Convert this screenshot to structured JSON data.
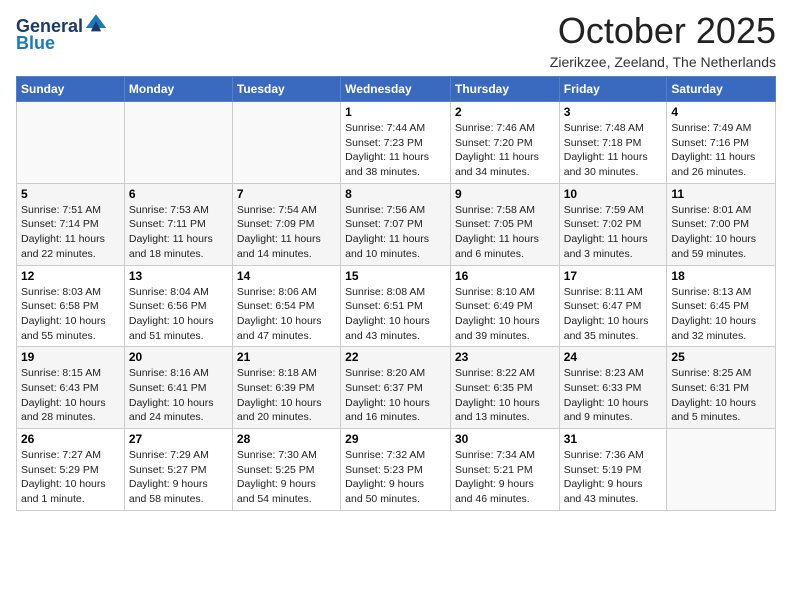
{
  "header": {
    "logo_line1": "General",
    "logo_line2": "Blue",
    "title": "October 2025",
    "location": "Zierikzee, Zeeland, The Netherlands"
  },
  "weekdays": [
    "Sunday",
    "Monday",
    "Tuesday",
    "Wednesday",
    "Thursday",
    "Friday",
    "Saturday"
  ],
  "weeks": [
    [
      {
        "day": "",
        "info": ""
      },
      {
        "day": "",
        "info": ""
      },
      {
        "day": "",
        "info": ""
      },
      {
        "day": "1",
        "info": "Sunrise: 7:44 AM\nSunset: 7:23 PM\nDaylight: 11 hours\nand 38 minutes."
      },
      {
        "day": "2",
        "info": "Sunrise: 7:46 AM\nSunset: 7:20 PM\nDaylight: 11 hours\nand 34 minutes."
      },
      {
        "day": "3",
        "info": "Sunrise: 7:48 AM\nSunset: 7:18 PM\nDaylight: 11 hours\nand 30 minutes."
      },
      {
        "day": "4",
        "info": "Sunrise: 7:49 AM\nSunset: 7:16 PM\nDaylight: 11 hours\nand 26 minutes."
      }
    ],
    [
      {
        "day": "5",
        "info": "Sunrise: 7:51 AM\nSunset: 7:14 PM\nDaylight: 11 hours\nand 22 minutes."
      },
      {
        "day": "6",
        "info": "Sunrise: 7:53 AM\nSunset: 7:11 PM\nDaylight: 11 hours\nand 18 minutes."
      },
      {
        "day": "7",
        "info": "Sunrise: 7:54 AM\nSunset: 7:09 PM\nDaylight: 11 hours\nand 14 minutes."
      },
      {
        "day": "8",
        "info": "Sunrise: 7:56 AM\nSunset: 7:07 PM\nDaylight: 11 hours\nand 10 minutes."
      },
      {
        "day": "9",
        "info": "Sunrise: 7:58 AM\nSunset: 7:05 PM\nDaylight: 11 hours\nand 6 minutes."
      },
      {
        "day": "10",
        "info": "Sunrise: 7:59 AM\nSunset: 7:02 PM\nDaylight: 11 hours\nand 3 minutes."
      },
      {
        "day": "11",
        "info": "Sunrise: 8:01 AM\nSunset: 7:00 PM\nDaylight: 10 hours\nand 59 minutes."
      }
    ],
    [
      {
        "day": "12",
        "info": "Sunrise: 8:03 AM\nSunset: 6:58 PM\nDaylight: 10 hours\nand 55 minutes."
      },
      {
        "day": "13",
        "info": "Sunrise: 8:04 AM\nSunset: 6:56 PM\nDaylight: 10 hours\nand 51 minutes."
      },
      {
        "day": "14",
        "info": "Sunrise: 8:06 AM\nSunset: 6:54 PM\nDaylight: 10 hours\nand 47 minutes."
      },
      {
        "day": "15",
        "info": "Sunrise: 8:08 AM\nSunset: 6:51 PM\nDaylight: 10 hours\nand 43 minutes."
      },
      {
        "day": "16",
        "info": "Sunrise: 8:10 AM\nSunset: 6:49 PM\nDaylight: 10 hours\nand 39 minutes."
      },
      {
        "day": "17",
        "info": "Sunrise: 8:11 AM\nSunset: 6:47 PM\nDaylight: 10 hours\nand 35 minutes."
      },
      {
        "day": "18",
        "info": "Sunrise: 8:13 AM\nSunset: 6:45 PM\nDaylight: 10 hours\nand 32 minutes."
      }
    ],
    [
      {
        "day": "19",
        "info": "Sunrise: 8:15 AM\nSunset: 6:43 PM\nDaylight: 10 hours\nand 28 minutes."
      },
      {
        "day": "20",
        "info": "Sunrise: 8:16 AM\nSunset: 6:41 PM\nDaylight: 10 hours\nand 24 minutes."
      },
      {
        "day": "21",
        "info": "Sunrise: 8:18 AM\nSunset: 6:39 PM\nDaylight: 10 hours\nand 20 minutes."
      },
      {
        "day": "22",
        "info": "Sunrise: 8:20 AM\nSunset: 6:37 PM\nDaylight: 10 hours\nand 16 minutes."
      },
      {
        "day": "23",
        "info": "Sunrise: 8:22 AM\nSunset: 6:35 PM\nDaylight: 10 hours\nand 13 minutes."
      },
      {
        "day": "24",
        "info": "Sunrise: 8:23 AM\nSunset: 6:33 PM\nDaylight: 10 hours\nand 9 minutes."
      },
      {
        "day": "25",
        "info": "Sunrise: 8:25 AM\nSunset: 6:31 PM\nDaylight: 10 hours\nand 5 minutes."
      }
    ],
    [
      {
        "day": "26",
        "info": "Sunrise: 7:27 AM\nSunset: 5:29 PM\nDaylight: 10 hours\nand 1 minute."
      },
      {
        "day": "27",
        "info": "Sunrise: 7:29 AM\nSunset: 5:27 PM\nDaylight: 9 hours\nand 58 minutes."
      },
      {
        "day": "28",
        "info": "Sunrise: 7:30 AM\nSunset: 5:25 PM\nDaylight: 9 hours\nand 54 minutes."
      },
      {
        "day": "29",
        "info": "Sunrise: 7:32 AM\nSunset: 5:23 PM\nDaylight: 9 hours\nand 50 minutes."
      },
      {
        "day": "30",
        "info": "Sunrise: 7:34 AM\nSunset: 5:21 PM\nDaylight: 9 hours\nand 46 minutes."
      },
      {
        "day": "31",
        "info": "Sunrise: 7:36 AM\nSunset: 5:19 PM\nDaylight: 9 hours\nand 43 minutes."
      },
      {
        "day": "",
        "info": ""
      }
    ]
  ]
}
